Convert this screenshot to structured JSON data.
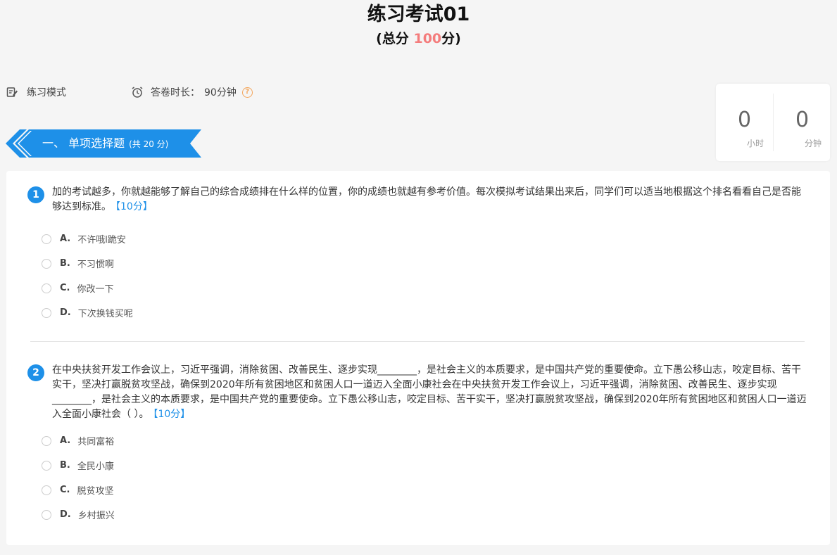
{
  "header": {
    "title": "练习考试01",
    "score_prefix": "(总分 ",
    "score_value": "100",
    "score_suffix": "分)"
  },
  "info": {
    "mode_label": "练习模式",
    "duration_label": "答卷时长：",
    "duration_value": "90分钟",
    "help_glyph": "?"
  },
  "timer": {
    "hours": "0",
    "hours_unit": "小时",
    "minutes": "0",
    "minutes_unit": "分钟"
  },
  "section": {
    "title": "一、 单项选择题",
    "count": "(共 20 分)"
  },
  "questions": [
    {
      "number": "1",
      "text": "加的考试越多，你就越能够了解自己的综合成绩排在什么样的位置，你的成绩也就越有参考价值。每次模拟考试结果出来后，同学们可以适当地根据这个排名看看自己是否能够达到标准。",
      "points": "【10分】",
      "options": [
        {
          "letter": "A.",
          "text": "不许哦l跪安"
        },
        {
          "letter": "B.",
          "text": "不习惯啊"
        },
        {
          "letter": "C.",
          "text": "你改一下"
        },
        {
          "letter": "D.",
          "text": "下次换钱买呢"
        }
      ]
    },
    {
      "number": "2",
      "text": "在中央扶贫开发工作会议上，习近平强调，消除贫困、改善民生、逐步实现________，是社会主义的本质要求，是中国共产党的重要使命。立下愚公移山志，咬定目标、苦干实干，坚决打赢脱贫攻坚战，确保到2020年所有贫困地区和贫困人口一道迈入全面小康社会在中央扶贫开发工作会议上，习近平强调，消除贫困、改善民生、逐步实现________，是社会主义的本质要求，是中国共产党的重要使命。立下愚公移山志，咬定目标、苦干实干，坚决打赢脱贫攻坚战，确保到2020年所有贫困地区和贫困人口一道迈入全面小康社会（ ）。",
      "points": "【10分】",
      "options": [
        {
          "letter": "A.",
          "text": "共同富裕"
        },
        {
          "letter": "B.",
          "text": "全民小康"
        },
        {
          "letter": "C.",
          "text": "脱贫攻坚"
        },
        {
          "letter": "D.",
          "text": "乡村振兴"
        }
      ]
    }
  ],
  "colors": {
    "accent_blue": "#1e90e8",
    "score_red": "#f47c7c",
    "help_orange": "#f3a65c"
  }
}
